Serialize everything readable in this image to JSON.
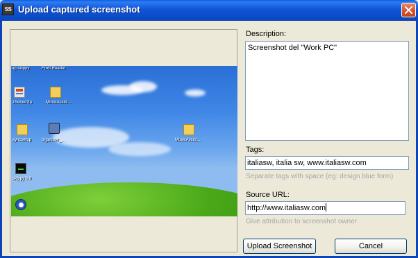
{
  "window": {
    "title": "Upload captured screenshot",
    "app_icon_text": "SS",
    "close_icon": "close-icon",
    "accent_color": "#0b45b8",
    "close_color": "#d8572e"
  },
  "form": {
    "description_label": "Description:",
    "description_value": "Screenshot del \"Work PC\"",
    "tags_label": "Tags:",
    "tags_value": "italiasw, italia sw, www.italiasw.com",
    "tags_hint": "Separate tags with space (eg: design blue form)",
    "source_label": "Source URL:",
    "source_value": "http://www.italiasw.com",
    "source_hint": "Give attribution to screenshot owner"
  },
  "buttons": {
    "upload": "Upload Screenshot",
    "cancel": "Cancel"
  },
  "preview": {
    "desktop_labels": {
      "top_left": "up.skippy",
      "top_right": "Foxit Reader",
      "row1_a": "zServerXp",
      "row1_b": "MusicAssist...",
      "row2_a": "syncsetup",
      "row2_b": "organizer_...",
      "row2_c": "MusicAssist...",
      "row3_a": "skippy 3.0"
    }
  }
}
